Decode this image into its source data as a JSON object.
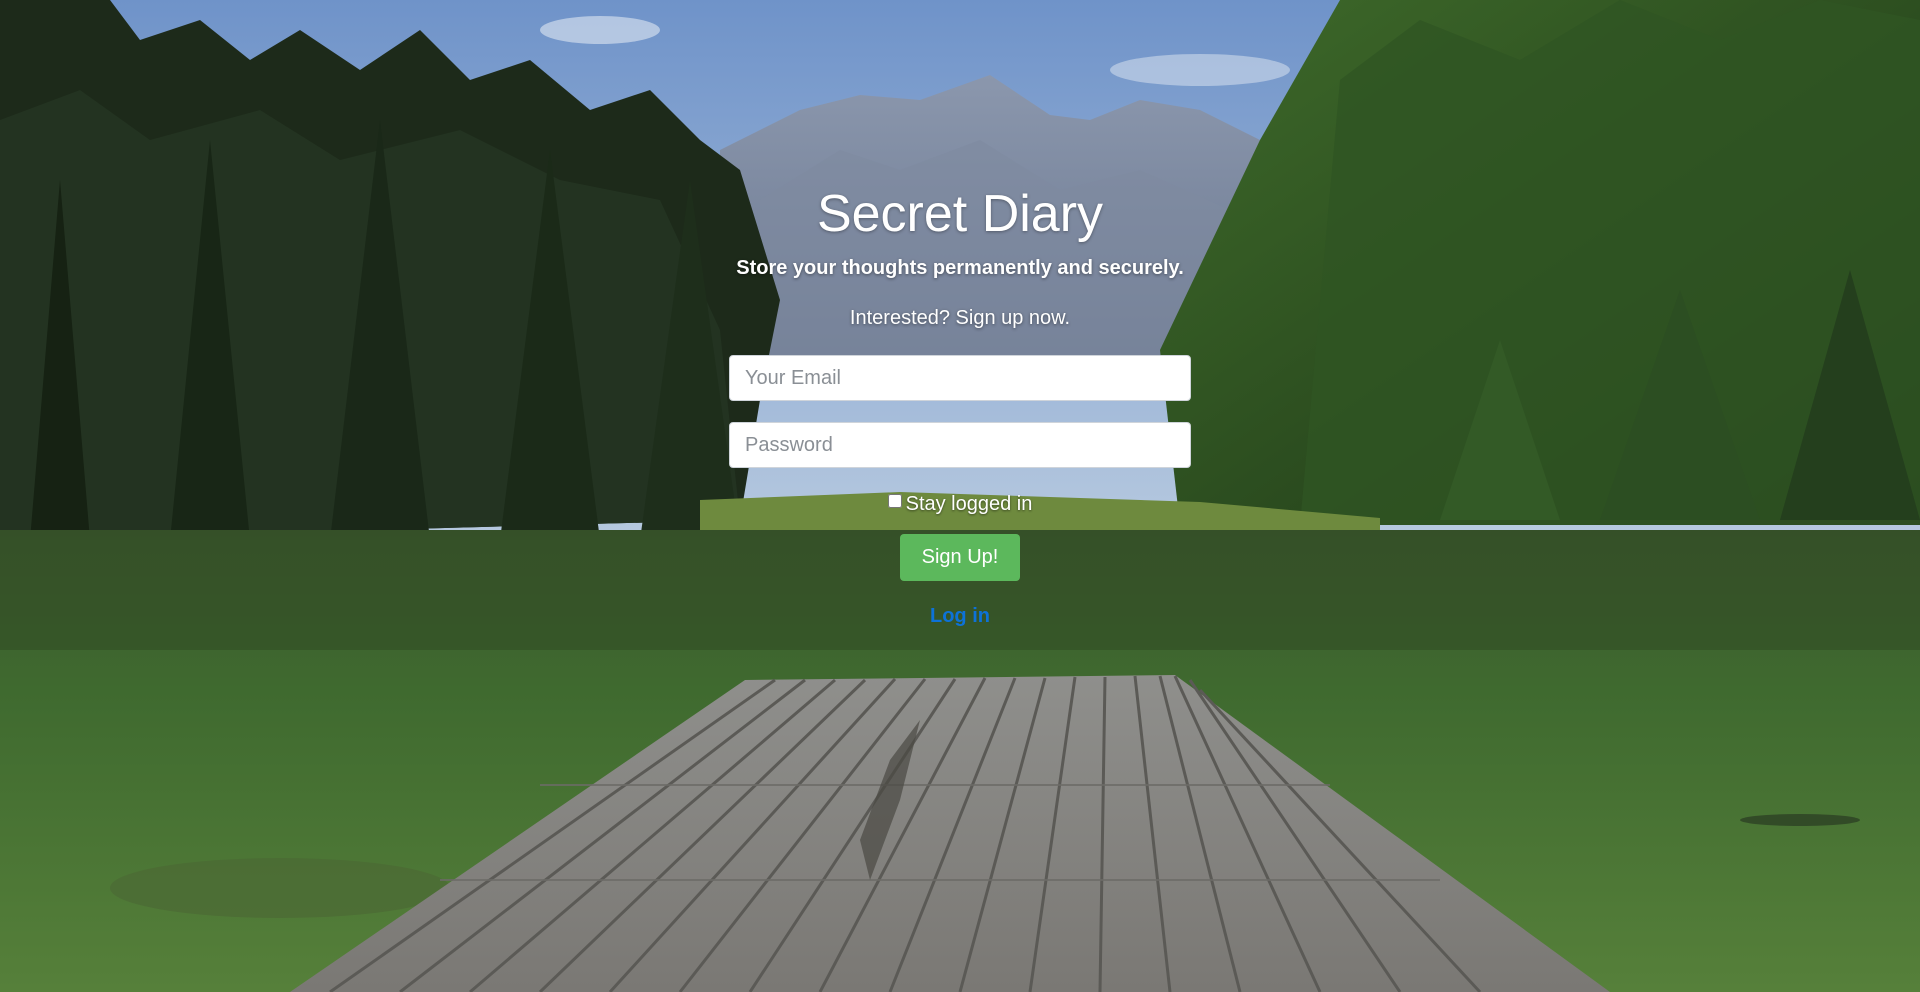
{
  "app": {
    "title": "Secret Diary",
    "tagline": "Store your thoughts permanently and securely.",
    "signup_prompt": "Interested? Sign up now."
  },
  "form": {
    "email_placeholder": "Your Email",
    "password_placeholder": "Password",
    "stay_logged_in_label": "Stay logged in",
    "stay_logged_in_checked": false,
    "submit_label": "Sign Up!",
    "toggle_link_label": "Log in"
  },
  "colors": {
    "submit_button": "#5cb85c",
    "link": "#0d72d8",
    "text": "#ffffff"
  }
}
